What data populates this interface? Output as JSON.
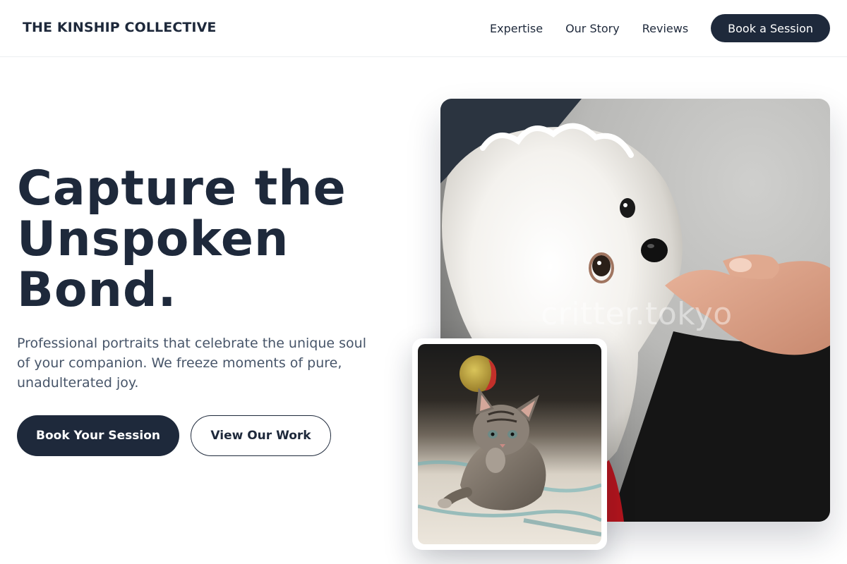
{
  "header": {
    "brand": "THE KINSHIP COLLECTIVE",
    "nav": [
      {
        "label": "Expertise"
      },
      {
        "label": "Our Story"
      },
      {
        "label": "Reviews"
      }
    ],
    "cta_label": "Book a Session"
  },
  "hero": {
    "title_lines": [
      "Capture the",
      "Unspoken",
      "Bond."
    ],
    "subtitle": "Professional portraits that celebrate the unique soul of your companion. We freeze moments of pure, unadulterated joy.",
    "primary_button": "Book Your Session",
    "secondary_button": "View Our Work"
  },
  "images": {
    "main_watermark": "critter.tokyo"
  },
  "colors": {
    "primary": "#1e293b",
    "text_muted": "#475569",
    "background": "#ffffff"
  }
}
